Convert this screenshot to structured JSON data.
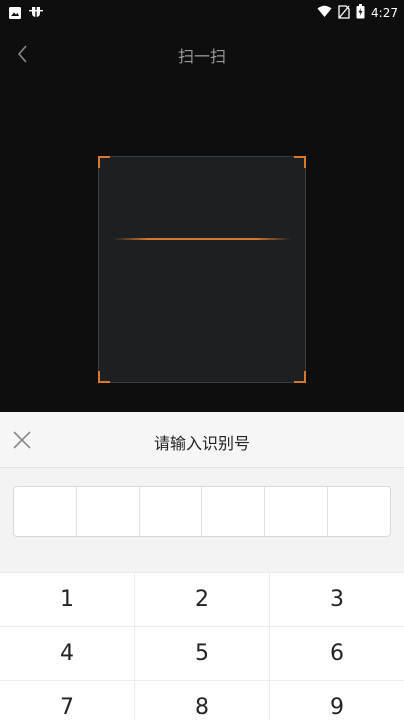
{
  "status_bar": {
    "time": "4:27",
    "left_icons": [
      "image-icon",
      "bug-icon"
    ],
    "right_icons": [
      "wifi-icon",
      "no-sim-icon",
      "battery-icon"
    ]
  },
  "header": {
    "title": "扫一扫"
  },
  "sheet": {
    "title": "请输入识别号",
    "code_box_count": 6
  },
  "keypad": {
    "rows": [
      [
        "1",
        "2",
        "3"
      ],
      [
        "4",
        "5",
        "6"
      ],
      [
        "7",
        "8",
        "9"
      ]
    ]
  },
  "colors": {
    "background": "#0e0e0e",
    "scan_accent": "#d9782a",
    "sheet_bg": "#f3f3f3"
  }
}
